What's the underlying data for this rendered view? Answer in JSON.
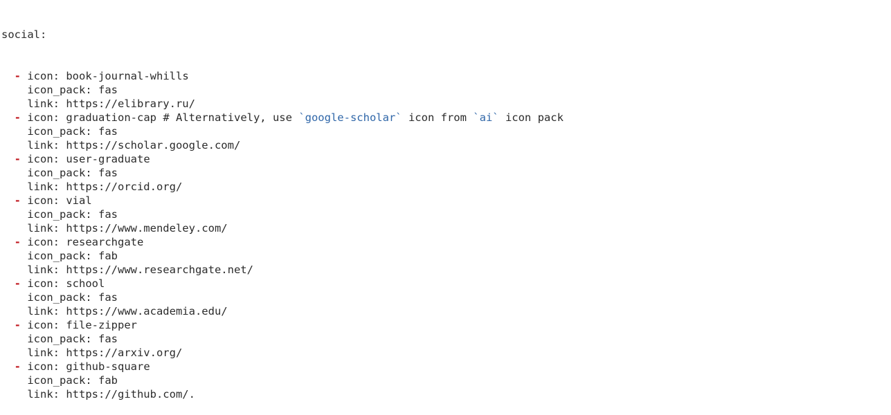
{
  "header": "social:",
  "entries": [
    {
      "icon": "book-journal-whills",
      "icon_pack": "fas",
      "link": "https://elibrary.ru/"
    },
    {
      "icon": "graduation-cap",
      "comment_pre": " # Alternatively, use ",
      "comment_str1": "`google-scholar`",
      "comment_mid": " icon from ",
      "comment_str2": "`ai`",
      "comment_post": " icon pack",
      "icon_pack": "fas",
      "link": "https://scholar.google.com/"
    },
    {
      "icon": "user-graduate",
      "icon_pack": "fas",
      "link": "https://orcid.org/"
    },
    {
      "icon": "vial",
      "icon_pack": "fas",
      "link": "https://www.mendeley.com/"
    },
    {
      "icon": "researchgate",
      "icon_pack": "fab",
      "link": "https://www.researchgate.net/"
    },
    {
      "icon": "school",
      "icon_pack": "fas",
      "link": "https://www.academia.edu/"
    },
    {
      "icon": "file-zipper",
      "icon_pack": "fas",
      "link": "https://arxiv.org/"
    },
    {
      "icon": "github-square",
      "icon_pack": "fab",
      "link": "https://github.com/."
    }
  ],
  "labels": {
    "dash": "- ",
    "icon_key": "icon: ",
    "icon_pack_key": "icon_pack: ",
    "link_key": "link: "
  }
}
